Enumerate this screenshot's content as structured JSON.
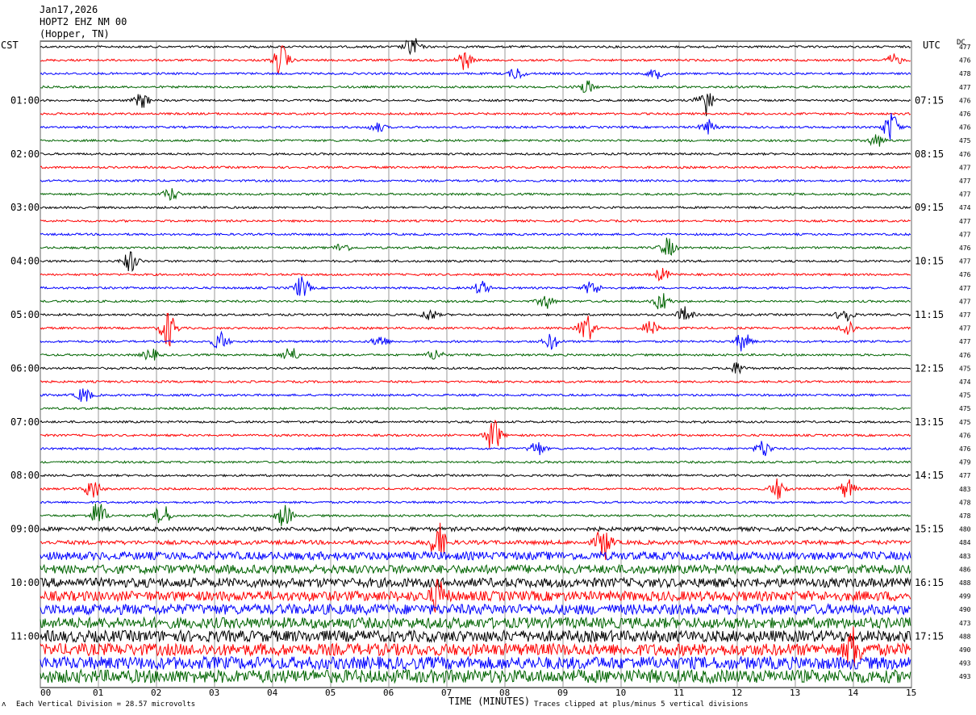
{
  "header": {
    "date": "Jan17,2026",
    "station": "HOPT2 EHZ NM 00",
    "location": "(Hopper, TN)"
  },
  "left_tz": "CST",
  "right_tz": "UTC",
  "dc_label": "DC",
  "footer": {
    "x_axis_label": "TIME (MINUTES)",
    "scale_note": "Each Vertical Division =  28.57 microvolts",
    "clip_note": "Traces clipped at plus/minus 5 vertical divisions"
  },
  "chart_data": {
    "type": "helicorder",
    "xlabel": "TIME (MINUTES)",
    "xlim": [
      0,
      15
    ],
    "x_ticks": [
      "00",
      "01",
      "02",
      "03",
      "04",
      "05",
      "06",
      "07",
      "08",
      "09",
      "10",
      "11",
      "12",
      "13",
      "14",
      "15"
    ],
    "row_minutes": 15,
    "row_count": 48,
    "trace_colors": [
      "#000000",
      "#ff0000",
      "#0000ff",
      "#006400"
    ],
    "left_hour_labels": [
      "01:00",
      "02:00",
      "03:00",
      "04:00",
      "05:00",
      "06:00",
      "07:00",
      "08:00",
      "09:00",
      "10:00",
      "11:00"
    ],
    "right_hour_labels": [
      "07:15",
      "08:15",
      "09:15",
      "10:15",
      "11:15",
      "12:15",
      "13:15",
      "14:15",
      "15:15",
      "16:15",
      "17:15"
    ],
    "dc_offsets": [
      477,
      476,
      478,
      477,
      476,
      476,
      476,
      475,
      476,
      477,
      477,
      477,
      474,
      477,
      477,
      476,
      477,
      476,
      477,
      477,
      477,
      477,
      477,
      476,
      475,
      474,
      475,
      475,
      475,
      476,
      476,
      479,
      477,
      483,
      478,
      478,
      480,
      484,
      483,
      486,
      488,
      499,
      490,
      473,
      488,
      490,
      493,
      493
    ],
    "events": [
      {
        "row": 0,
        "minute": 6.4,
        "amp": 2.2
      },
      {
        "row": 1,
        "minute": 4.15,
        "amp": 3.2
      },
      {
        "row": 1,
        "minute": 7.3,
        "amp": 2.0
      },
      {
        "row": 1,
        "minute": 14.7,
        "amp": 1.2
      },
      {
        "row": 2,
        "minute": 8.2,
        "amp": 1.2
      },
      {
        "row": 2,
        "minute": 10.6,
        "amp": 1.0
      },
      {
        "row": 3,
        "minute": 9.4,
        "amp": 1.4
      },
      {
        "row": 4,
        "minute": 1.75,
        "amp": 1.6
      },
      {
        "row": 4,
        "minute": 11.45,
        "amp": 3.5
      },
      {
        "row": 6,
        "minute": 14.65,
        "amp": 3.2
      },
      {
        "row": 6,
        "minute": 5.8,
        "amp": 1.0
      },
      {
        "row": 6,
        "minute": 11.5,
        "amp": 1.5
      },
      {
        "row": 7,
        "minute": 14.4,
        "amp": 1.3
      },
      {
        "row": 11,
        "minute": 2.25,
        "amp": 1.4
      },
      {
        "row": 15,
        "minute": 5.2,
        "amp": 1.0
      },
      {
        "row": 15,
        "minute": 10.8,
        "amp": 2.0
      },
      {
        "row": 16,
        "minute": 1.55,
        "amp": 2.2
      },
      {
        "row": 17,
        "minute": 10.7,
        "amp": 1.3
      },
      {
        "row": 18,
        "minute": 4.5,
        "amp": 2.3
      },
      {
        "row": 18,
        "minute": 7.6,
        "amp": 1.4
      },
      {
        "row": 18,
        "minute": 9.5,
        "amp": 1.6
      },
      {
        "row": 19,
        "minute": 8.7,
        "amp": 1.5
      },
      {
        "row": 19,
        "minute": 10.7,
        "amp": 2.0
      },
      {
        "row": 20,
        "minute": 6.7,
        "amp": 1.2
      },
      {
        "row": 20,
        "minute": 11.1,
        "amp": 1.6
      },
      {
        "row": 20,
        "minute": 13.85,
        "amp": 1.8
      },
      {
        "row": 21,
        "minute": 2.2,
        "amp": 4.0
      },
      {
        "row": 21,
        "minute": 9.4,
        "amp": 3.0
      },
      {
        "row": 21,
        "minute": 10.5,
        "amp": 1.6
      },
      {
        "row": 21,
        "minute": 13.9,
        "amp": 1.8
      },
      {
        "row": 22,
        "minute": 3.1,
        "amp": 2.0
      },
      {
        "row": 22,
        "minute": 5.85,
        "amp": 1.4
      },
      {
        "row": 22,
        "minute": 8.8,
        "amp": 1.6
      },
      {
        "row": 22,
        "minute": 12.1,
        "amp": 2.0
      },
      {
        "row": 23,
        "minute": 1.9,
        "amp": 1.3
      },
      {
        "row": 23,
        "minute": 4.3,
        "amp": 1.8
      },
      {
        "row": 23,
        "minute": 6.8,
        "amp": 1.2
      },
      {
        "row": 24,
        "minute": 12.0,
        "amp": 1.2
      },
      {
        "row": 26,
        "minute": 0.75,
        "amp": 1.6
      },
      {
        "row": 29,
        "minute": 7.8,
        "amp": 3.8
      },
      {
        "row": 30,
        "minute": 8.55,
        "amp": 1.6
      },
      {
        "row": 30,
        "minute": 12.45,
        "amp": 1.8
      },
      {
        "row": 33,
        "minute": 0.9,
        "amp": 2.2
      },
      {
        "row": 33,
        "minute": 12.7,
        "amp": 2.2
      },
      {
        "row": 33,
        "minute": 13.9,
        "amp": 2.0
      },
      {
        "row": 35,
        "minute": 1.0,
        "amp": 3.0
      },
      {
        "row": 35,
        "minute": 2.1,
        "amp": 2.5
      },
      {
        "row": 35,
        "minute": 4.2,
        "amp": 2.5
      },
      {
        "row": 37,
        "minute": 6.85,
        "amp": 4.0
      },
      {
        "row": 37,
        "minute": 9.7,
        "amp": 3.5
      },
      {
        "row": 41,
        "minute": 6.85,
        "amp": 3.0
      },
      {
        "row": 45,
        "minute": 14.0,
        "amp": 4.0
      }
    ]
  }
}
